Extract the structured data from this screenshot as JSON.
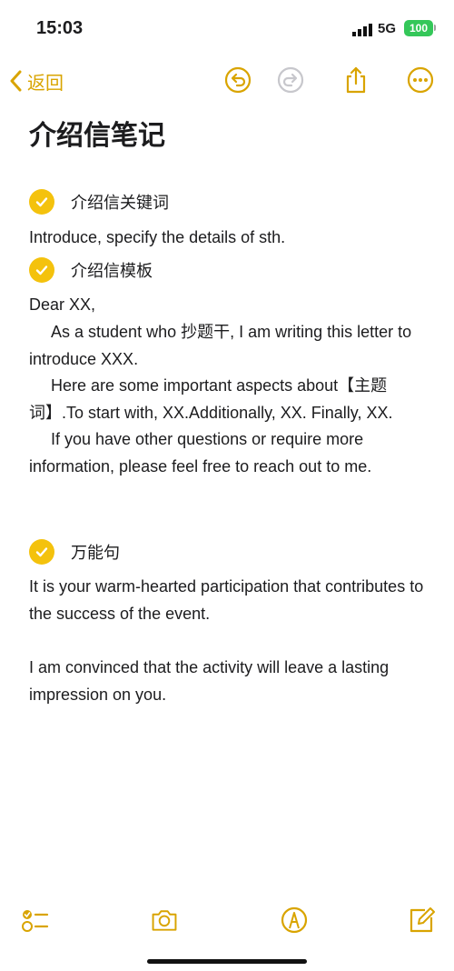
{
  "status": {
    "time": "15:03",
    "network": "5G",
    "battery": "100"
  },
  "toolbar": {
    "back_label": "返回"
  },
  "note": {
    "title": "介绍信笔记",
    "sections": [
      {
        "heading": "介绍信关键词"
      },
      {
        "heading": "介绍信模板"
      },
      {
        "heading": "万能句"
      }
    ],
    "lines": {
      "keywords": "Introduce, specify the details of sth.",
      "template_1": "Dear XX,",
      "template_2": "As a student who 抄题干, I am writing this letter to introduce XXX.",
      "template_3": "Here are some important aspects about【主题词】.To start with, XX.Additionally, XX. Finally, XX.",
      "template_4": "If you have other questions or require more information, please feel free to reach out to me.",
      "phrase_1": "It is your warm-hearted participation that contributes to the success of the event.",
      "phrase_2": "I am convinced that the activity will leave a lasting impression on you."
    }
  },
  "colors": {
    "accent": "#d9a400",
    "check": "#f4c20d",
    "battery": "#34c759"
  },
  "icons": [
    "back-chevron-icon",
    "undo-icon",
    "redo-icon",
    "share-icon",
    "more-icon",
    "checklist-icon",
    "camera-icon",
    "markup-icon",
    "compose-icon"
  ]
}
